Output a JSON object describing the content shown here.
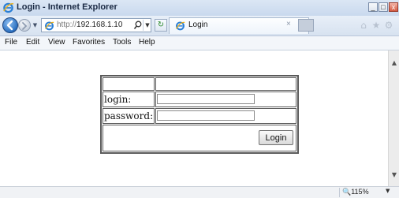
{
  "window": {
    "title": "Login - Internet Explorer",
    "min_glyph": "_",
    "max_glyph": "□",
    "close_glyph": "x"
  },
  "navbar": {
    "address_protocol": "http://",
    "address_host": "192.168.1.10",
    "tab_label": "Login",
    "tab_close_glyph": "×",
    "refresh_glyph": "↻"
  },
  "menu": [
    "File",
    "Edit",
    "View",
    "Favorites",
    "Tools",
    "Help"
  ],
  "form": {
    "login_label": "login:",
    "password_label": "password:",
    "login_value": "",
    "password_value": "",
    "submit_label": "Login"
  },
  "status": {
    "zoom": "115%"
  },
  "colors": {
    "ie_blue": "#2a6fc0",
    "table_border": "#5a5a5a"
  }
}
